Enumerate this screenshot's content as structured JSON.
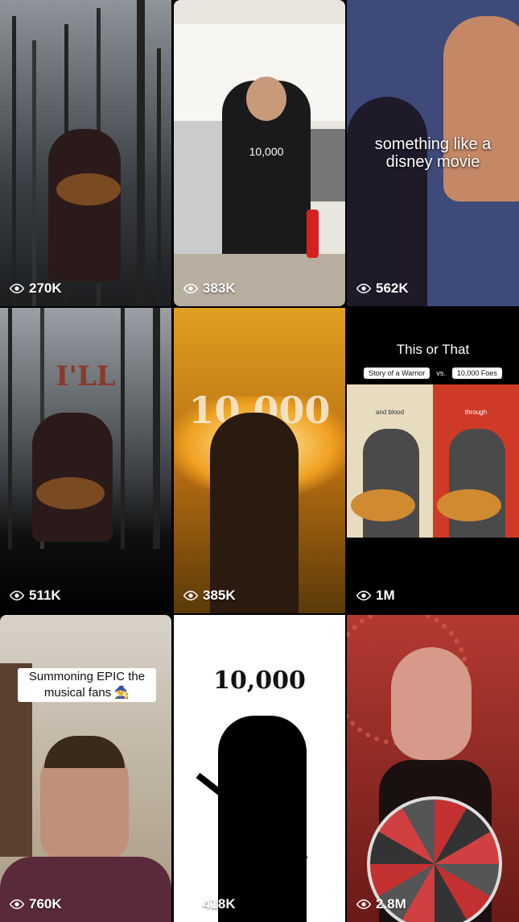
{
  "tiles": [
    {
      "views": "270K"
    },
    {
      "views": "383K",
      "shirt_text": "10,000"
    },
    {
      "views": "562K",
      "caption": "something like a disney movie"
    },
    {
      "views": "511K",
      "overlay": "I'LL"
    },
    {
      "views": "385K",
      "overlay": "10,000"
    },
    {
      "views": "1M",
      "title": "This or That",
      "left_label": "Story of a Warrior",
      "vs": "vs.",
      "right_label": "10,000 Foes",
      "left_sub": "and blood",
      "right_sub": "through"
    },
    {
      "views": "760K",
      "caption": "Summoning EPIC the musical fans 🧙"
    },
    {
      "views": "418K",
      "overlay": "10,000"
    },
    {
      "views": "2.8M"
    }
  ],
  "icons": {
    "views": "eye-icon"
  }
}
